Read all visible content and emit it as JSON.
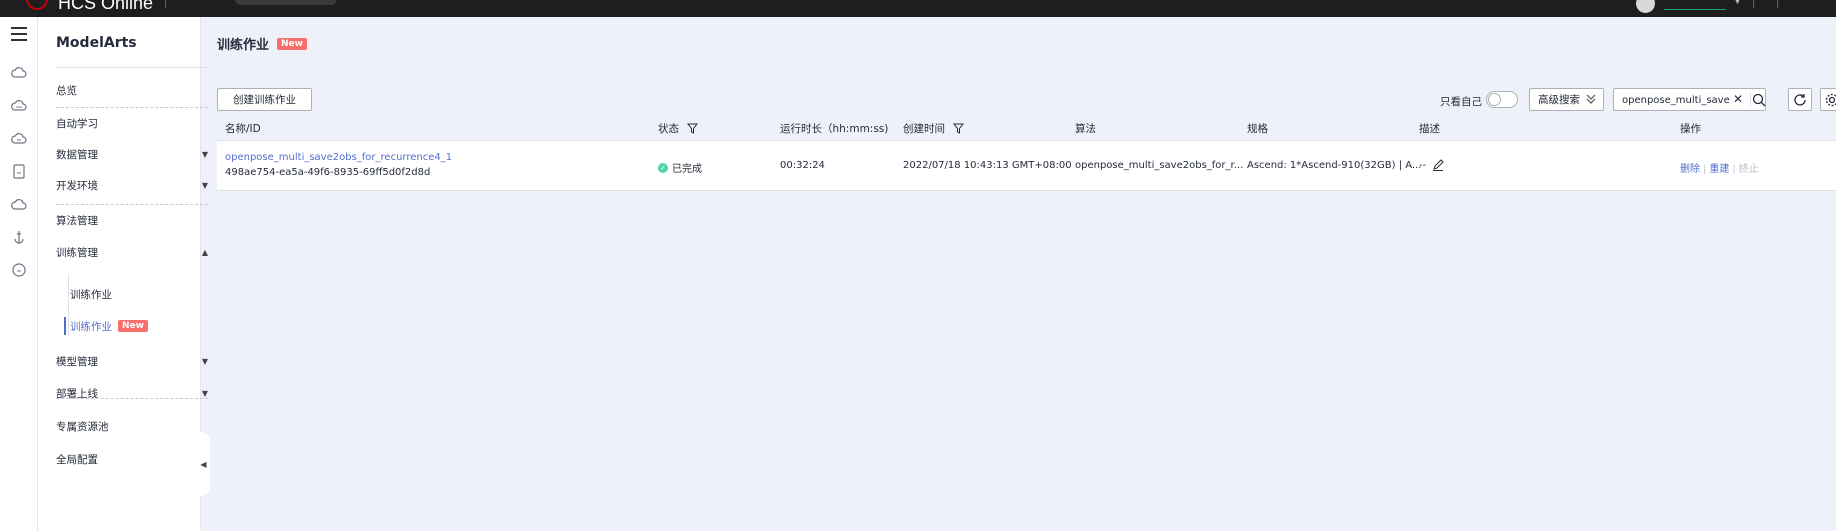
{
  "topbar": {
    "brand": "HCS Online",
    "colors": {
      "background": "#1e1e1e",
      "logo": "#c7000b"
    }
  },
  "rail": {
    "icons": [
      "cloud-icon",
      "cloud-chat-icon",
      "cloud-db-icon",
      "document-icon",
      "cloud-storage-icon",
      "anchor-icon",
      "support-icon"
    ]
  },
  "sidebar": {
    "title": "ModelArts",
    "items": {
      "overview": "总览",
      "automl": "自动学习",
      "data_mgmt": "数据管理",
      "dev_env": "开发环境",
      "algo_mgmt": "算法管理",
      "train_mgmt": "训练管理",
      "train_sub_1": "训练作业",
      "train_sub_2": "训练作业",
      "model_mgmt": "模型管理",
      "deploy": "部署上线",
      "dedicated_pool": "专属资源池",
      "global_config": "全局配置"
    },
    "new_badge": "New"
  },
  "main": {
    "title": "训练作业",
    "title_badge": "New",
    "create_button": "创建训练作业",
    "only_self_label": "只看自己",
    "only_self_on": false,
    "advanced_search": "高级搜索",
    "search_value": "openpose_multi_save..."
  },
  "table": {
    "headers": {
      "name": "名称/ID",
      "status": "状态",
      "duration": "运行时长（hh:mm:ss)",
      "created": "创建时间",
      "algorithm": "算法",
      "spec": "规格",
      "desc": "描述",
      "ops": "操作"
    },
    "rows": [
      {
        "name": "openpose_multi_save2obs_for_recurrence4_1",
        "id": "498ae754-ea5a-49f6-8935-69ff5d0f2d8d",
        "status": "已完成",
        "duration": "00:32:24",
        "created": "2022/07/18 10:43:13 GMT+08:00",
        "algorithm": "openpose_multi_save2obs_for_r...",
        "spec": "Ascend: 1*Ascend-910(32GB) | A...",
        "desc": "--",
        "op_delete": "删除",
        "op_rebuild": "重建",
        "op_stop": "终止"
      }
    ]
  },
  "colors": {
    "accent": "#526ecc",
    "badge": "#f66f6a",
    "success": "#50d4ab",
    "page_bg": "#eef0fa"
  }
}
